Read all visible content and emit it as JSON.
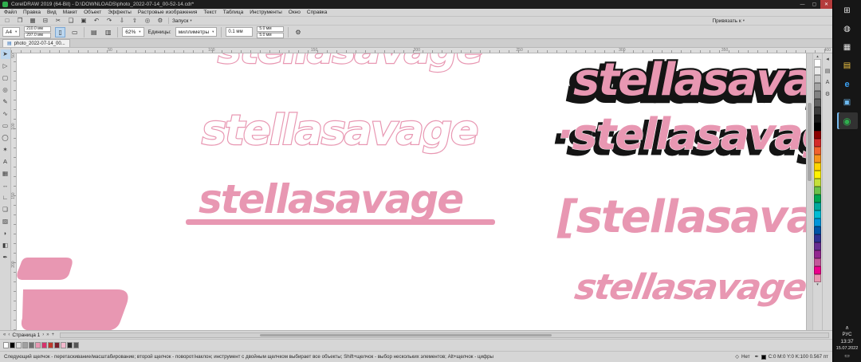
{
  "colors": {
    "logo_pink": "#e897b2",
    "shadow_black": "#141414",
    "selection_blue": "#bcd6ee",
    "taskbar_green": "#2fae4e",
    "explorer_yellow": "#f3c744",
    "edge_blue": "#3aa0f3"
  },
  "ui": {
    "caret": "▾"
  },
  "titlebar": {
    "title": "CorelDRAW 2019 (64-Bit) - D:\\DOWNLOADS\\photo_2022-07-14_00-52-14.cdr*",
    "minimize": "—",
    "maximize": "▢",
    "close": "✕"
  },
  "menubar": {
    "items": [
      "Файл",
      "Правка",
      "Вид",
      "Макет",
      "Объект",
      "Эффекты",
      "Растровые изображения",
      "Текст",
      "Таблица",
      "Инструменты",
      "Окно",
      "Справка"
    ]
  },
  "toolbar": {
    "icons": [
      {
        "name": "new-icon",
        "glyph": "□"
      },
      {
        "name": "open-icon",
        "glyph": "❐"
      },
      {
        "name": "save-icon",
        "glyph": "▦"
      },
      {
        "name": "print-icon",
        "glyph": "⊟"
      },
      {
        "name": "cut-icon",
        "glyph": "✂"
      },
      {
        "name": "copy-icon",
        "glyph": "❑"
      },
      {
        "name": "paste-icon",
        "glyph": "▣"
      },
      {
        "name": "undo-icon",
        "glyph": "↶"
      },
      {
        "name": "redo-icon",
        "glyph": "↷"
      },
      {
        "name": "import-icon",
        "glyph": "⇩"
      },
      {
        "name": "export-icon",
        "glyph": "⇧"
      },
      {
        "name": "search-icon",
        "glyph": "◎"
      },
      {
        "name": "options-icon",
        "glyph": "⚙"
      }
    ],
    "launch_label": "Запуск",
    "snap_label": "Привязать к"
  },
  "property_bar": {
    "page_size": "A4",
    "width_value": "210.0 мм",
    "height_value": "297.0 мм",
    "portrait_icon": "▯",
    "landscape_icon": "▭",
    "pages_icon_a": "▤",
    "pages_icon_b": "▥",
    "zoom_value": "62%",
    "units_label": "Единицы:",
    "units_value": "миллиметры",
    "nudge_value": "0.1 мм",
    "dup_x": "5.0 мм",
    "dup_y": "5.0 мм"
  },
  "document_tabs": {
    "icon": "▤",
    "active_label": "photo_2022-07-14_00..."
  },
  "rulers": {
    "h_labels": [
      "50",
      "100",
      "150",
      "200",
      "250",
      "300",
      "350",
      "400"
    ],
    "v_labels": [
      "50",
      "100",
      "150",
      "200"
    ]
  },
  "toolbox": {
    "tools": [
      {
        "name": "pick-tool",
        "glyph": "➤",
        "active": true
      },
      {
        "name": "shape-tool",
        "glyph": "▷"
      },
      {
        "name": "crop-tool",
        "glyph": "▢"
      },
      {
        "name": "zoom-tool",
        "glyph": "◎"
      },
      {
        "name": "freehand-tool",
        "glyph": "✎"
      },
      {
        "name": "artistic-media-tool",
        "glyph": "∿"
      },
      {
        "name": "rectangle-tool",
        "glyph": "▭"
      },
      {
        "name": "ellipse-tool",
        "glyph": "◯"
      },
      {
        "name": "polygon-tool",
        "glyph": "✶"
      },
      {
        "name": "text-tool",
        "glyph": "A"
      },
      {
        "name": "table-tool",
        "glyph": "▦"
      },
      {
        "name": "dimension-tool",
        "glyph": "↔"
      },
      {
        "name": "connector-tool",
        "glyph": "∟"
      },
      {
        "name": "drop-shadow-tool",
        "glyph": "❏"
      },
      {
        "name": "transparency-tool",
        "glyph": "▨"
      },
      {
        "name": "eyedropper-tool",
        "glyph": "◗"
      },
      {
        "name": "interactive-fill-tool",
        "glyph": "◧"
      },
      {
        "name": "outline-pen-tool",
        "glyph": "✒"
      }
    ]
  },
  "canvas": {
    "logo_text": "stellasavage",
    "logo_text_dot": "·stellasavage",
    "logo_text_bracket": "[stellasavage"
  },
  "palette": {
    "up": "▴",
    "down": "▾",
    "colors": [
      "#ffffff",
      "#ebebeb",
      "#c8c8c8",
      "#a5a5a5",
      "#828282",
      "#5f5f5f",
      "#3c3c3c",
      "#191919",
      "#000000",
      "#8b0000",
      "#d42a2a",
      "#f2622e",
      "#f7941d",
      "#ffd400",
      "#fff200",
      "#c5e03a",
      "#6cc24a",
      "#00a651",
      "#00a99d",
      "#00bcd4",
      "#0095da",
      "#0054a6",
      "#2e3192",
      "#662d91",
      "#92278f",
      "#c4579a",
      "#ec008c",
      "#e897b2"
    ]
  },
  "page_bar": {
    "first": "«",
    "prev": "‹",
    "label": "Страница 1",
    "next": "›",
    "last": "»",
    "add": "+"
  },
  "swatch_bar": {
    "colors": [
      "#ffffff",
      "#000000",
      "#e0e0e0",
      "#a0a0a0",
      "#6f6f6f",
      "#e897b2",
      "#d6336c",
      "#c0392b",
      "#7a1f2b",
      "#f2b8cc",
      "#2b2b2b",
      "#555555"
    ]
  },
  "status_bar": {
    "hint": "Следующий щелчок - перетаскивание/масштабирование; второй щелчок - поворот/наклон; инструмент с двойным щелчком выбирает все объекты; Shift+щелчок - выбор нескольких элементов; Alt+щелчок - цифры",
    "fill_icon": "◇",
    "fill_label": "Нет",
    "outline_icon": "✒",
    "outline_info": "C:0 M:0 Y:0 K:100 0.567 пт"
  },
  "taskbar": {
    "start_glyph": "⊞",
    "search_glyph": "◍",
    "taskview_glyph": "▦",
    "explorer_glyph": "▤",
    "browser_glyph": "e",
    "photos_glyph": "▣",
    "corel_glyph": "◉",
    "chevron": "∧",
    "lang": "РУС",
    "time": "13:37",
    "date": "15.07.2022",
    "notif_glyph": "▭"
  }
}
